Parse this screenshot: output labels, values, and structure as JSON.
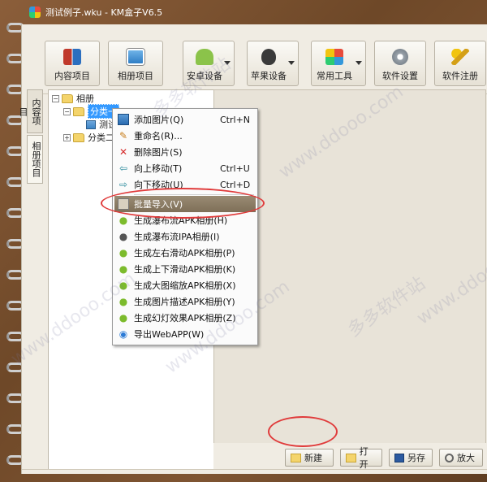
{
  "window": {
    "title": "测试例子.wku - KM盒子V6.5"
  },
  "toolbar": {
    "buttons": [
      {
        "label": "内容项目",
        "icon": "book-icon"
      },
      {
        "label": "相册项目",
        "icon": "album-icon"
      },
      {
        "label": "安卓设备",
        "icon": "android-icon"
      },
      {
        "label": "苹果设备",
        "icon": "apple-icon"
      },
      {
        "label": "常用工具",
        "icon": "tools-icon"
      },
      {
        "label": "软件设置",
        "icon": "gear-icon"
      },
      {
        "label": "软件注册",
        "icon": "key-icon"
      }
    ]
  },
  "side_tabs": [
    "内容项目",
    "相册项目"
  ],
  "tree": {
    "root": "相册",
    "category1": "分类一",
    "item1": "测试",
    "category2": "分类二"
  },
  "context_menu": {
    "items": [
      {
        "label": "添加图片(Q)",
        "shortcut": "Ctrl+N",
        "icon": "picture-icon"
      },
      {
        "label": "重命名(R)...",
        "shortcut": "",
        "icon": "rename-icon"
      },
      {
        "label": "删除图片(S)",
        "shortcut": "",
        "icon": "delete-icon"
      },
      {
        "label": "向上移动(T)",
        "shortcut": "Ctrl+U",
        "icon": "arrow-up-icon"
      },
      {
        "label": "向下移动(U)",
        "shortcut": "Ctrl+D",
        "icon": "arrow-down-icon"
      },
      {
        "label": "批量导入(V)",
        "shortcut": "",
        "icon": "batch-import-icon"
      },
      {
        "label": "生成瀑布流APK相册(H)",
        "shortcut": "",
        "icon": "android-icon"
      },
      {
        "label": "生成瀑布流IPA相册(I)",
        "shortcut": "",
        "icon": "apple-icon"
      },
      {
        "label": "生成左右滑动APK相册(P)",
        "shortcut": "",
        "icon": "android-icon"
      },
      {
        "label": "生成上下滑动APK相册(K)",
        "shortcut": "",
        "icon": "android-icon"
      },
      {
        "label": "生成大图缩放APK相册(X)",
        "shortcut": "",
        "icon": "android-icon"
      },
      {
        "label": "生成图片描述APK相册(Y)",
        "shortcut": "",
        "icon": "android-icon"
      },
      {
        "label": "生成幻灯效果APK相册(Z)",
        "shortcut": "",
        "icon": "android-icon"
      },
      {
        "label": "导出WebAPP(W)",
        "shortcut": "",
        "icon": "web-icon"
      }
    ]
  },
  "bottom_buttons": [
    {
      "label": "新建",
      "icon": "folder-icon"
    },
    {
      "label": "打开",
      "icon": "folder-open-icon"
    },
    {
      "label": "另存",
      "icon": "save-icon"
    },
    {
      "label": "放大",
      "icon": "zoom-icon"
    }
  ],
  "watermarks": [
    "www.ddooo.com",
    "多多软件站"
  ],
  "colors": {
    "frame": "#6e4828",
    "paper": "#f0ece3",
    "selection": "#3399ff",
    "menu_highlight": "#8a7b63",
    "annotation": "#e03b3b"
  }
}
